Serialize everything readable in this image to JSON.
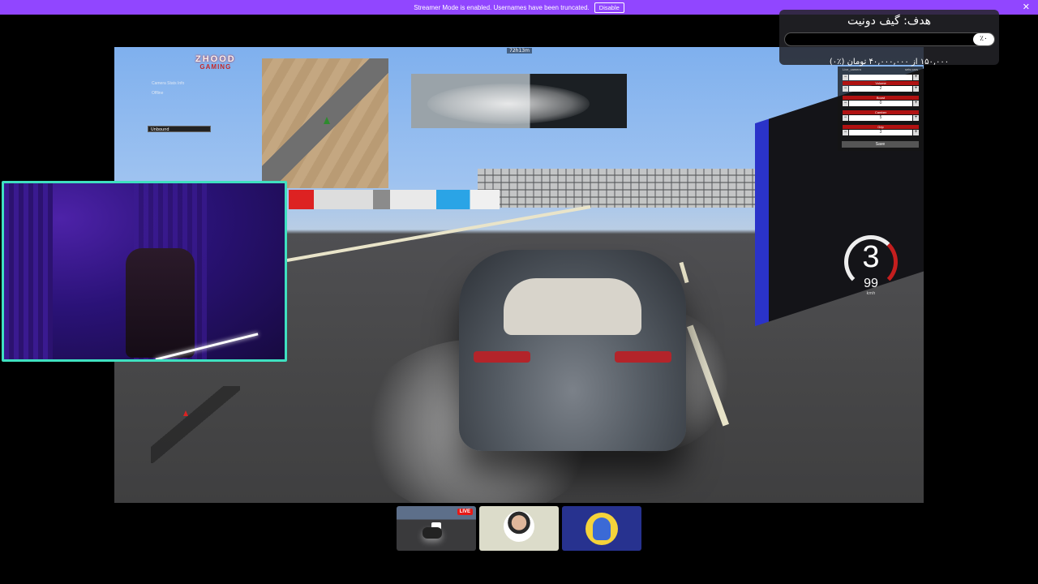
{
  "streamer_bar": {
    "message": "Streamer Mode is enabled. Usernames have been truncated.",
    "disable_label": "Disable",
    "close_glyph": "✕",
    "color": "#9146ff"
  },
  "game": {
    "logo_line1": "ZHOOD",
    "logo_line2": "GAMING",
    "timer": "72h13m",
    "tiny_label1": "Camera Stats Info",
    "tiny_label2": "Offline",
    "dropdown_value": "Unbound",
    "mod_panel": {
      "header_left": "Live_camera",
      "header_right": "sets   cars",
      "rows": [
        {
          "label": "",
          "value": ""
        },
        {
          "label": "Volume",
          "value": "2"
        },
        {
          "label": "Boost",
          "value": "0"
        },
        {
          "label": "Camber",
          "value": "5"
        },
        {
          "label": "Grip",
          "value": "3"
        }
      ],
      "minus": "−",
      "plus": "+",
      "save_label": "Save"
    },
    "gear": "3",
    "speed": "99",
    "speed_unit": "kmh"
  },
  "donation_goal": {
    "title": "هدف: گیف دونیت",
    "percent": "٪۰",
    "progress_fraction": 0,
    "amount_text": "۱۵۰,۰۰۰ از ۴۰,۰۰۰,۰۰۰ تومان (٪۰)"
  },
  "thumbnails": {
    "live_badge": "LIVE"
  }
}
